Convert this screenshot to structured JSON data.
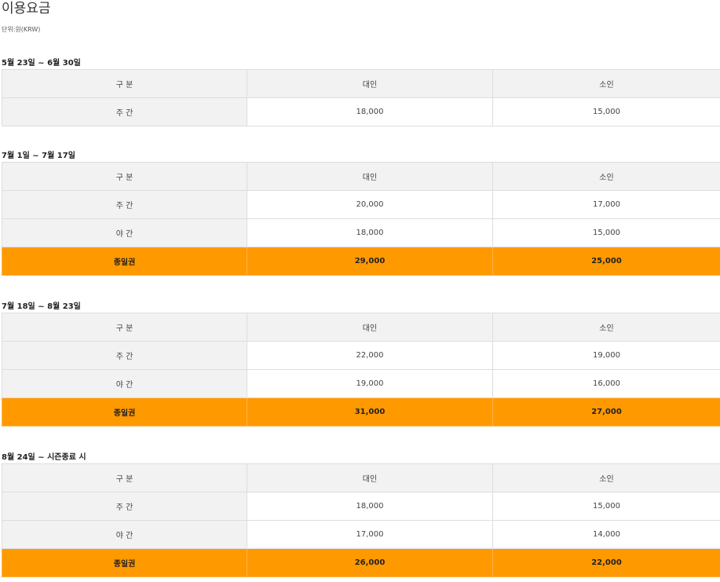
{
  "page": {
    "title": "이용요금",
    "unit": "단위:원(KRW)"
  },
  "colors": {
    "header_bg": "#f2f2f2",
    "highlight_bg": "#ff9900",
    "border": "#dddddd"
  },
  "sections": [
    {
      "title": "5월 23일 ~ 6월 30일",
      "headers": [
        "구 분",
        "대인",
        "소인"
      ],
      "rows": [
        {
          "label": "주 간",
          "adult": "18,000",
          "child": "15,000",
          "highlight": false
        }
      ]
    },
    {
      "title": "7월 1일 ~ 7월 17일",
      "headers": [
        "구 분",
        "대인",
        "소인"
      ],
      "rows": [
        {
          "label": "주 간",
          "adult": "20,000",
          "child": "17,000",
          "highlight": false
        },
        {
          "label": "야 간",
          "adult": "18,000",
          "child": "15,000",
          "highlight": false
        },
        {
          "label": "종일권",
          "adult": "29,000",
          "child": "25,000",
          "highlight": true
        }
      ]
    },
    {
      "title": "7월 18일 ~ 8월 23일",
      "headers": [
        "구 분",
        "대인",
        "소인"
      ],
      "rows": [
        {
          "label": "주 간",
          "adult": "22,000",
          "child": "19,000",
          "highlight": false
        },
        {
          "label": "야 간",
          "adult": "19,000",
          "child": "16,000",
          "highlight": false
        },
        {
          "label": "종일권",
          "adult": "31,000",
          "child": "27,000",
          "highlight": true
        }
      ]
    },
    {
      "title": "8월 24일 ~ 시즌종료 시",
      "headers": [
        "구 분",
        "대인",
        "소인"
      ],
      "rows": [
        {
          "label": "주 간",
          "adult": "18,000",
          "child": "15,000",
          "highlight": false
        },
        {
          "label": "야 간",
          "adult": "17,000",
          "child": "14,000",
          "highlight": false
        },
        {
          "label": "종일권",
          "adult": "26,000",
          "child": "22,000",
          "highlight": true
        }
      ]
    }
  ]
}
